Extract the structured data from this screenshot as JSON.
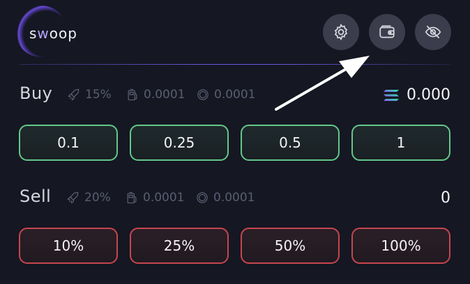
{
  "header": {
    "logo_prefix": "s",
    "logo_accent": "w",
    "logo_suffix": "oop",
    "buttons": [
      {
        "icon": "gear-icon"
      },
      {
        "icon": "wallet-icon"
      },
      {
        "icon": "eye-off-icon"
      }
    ]
  },
  "buy": {
    "title": "Buy",
    "slippage": "15%",
    "priority_fee": "0.0001",
    "tip": "0.0001",
    "balance": "0.000",
    "amounts": [
      "0.1",
      "0.25",
      "0.5",
      "1"
    ]
  },
  "sell": {
    "title": "Sell",
    "slippage": "20%",
    "priority_fee": "0.0001",
    "tip": "0.0001",
    "balance": "0",
    "amounts": [
      "10%",
      "25%",
      "50%",
      "100%"
    ]
  },
  "colors": {
    "background": "#151723",
    "buy_border": "#63c888",
    "sell_border": "#c6464e",
    "accent": "#6a5be0",
    "muted_text": "#5b5e70"
  }
}
